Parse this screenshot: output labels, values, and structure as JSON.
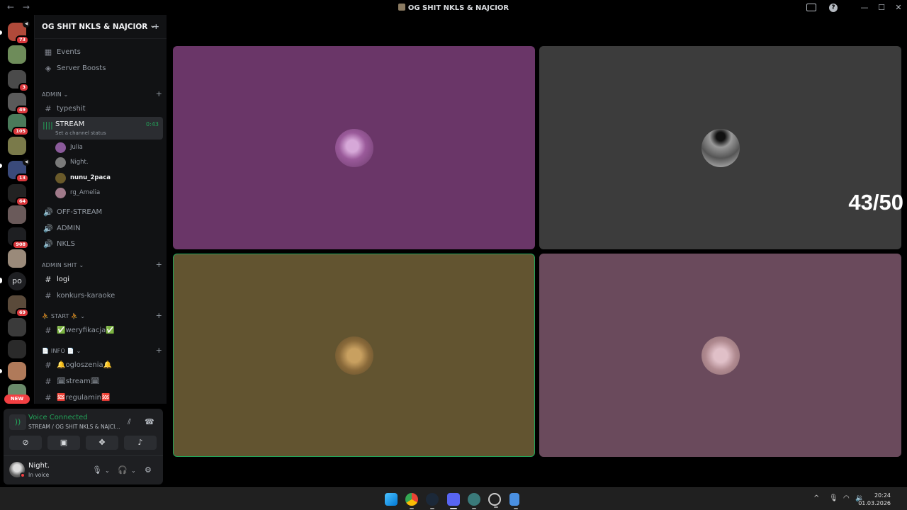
{
  "window": {
    "title": "OG SHIT NKLS & NAJCIOR",
    "back_glyph": "←",
    "forward_glyph": "→",
    "help_glyph": "?",
    "minimize_glyph": "—",
    "maximize_glyph": "☐",
    "close_glyph": "✕"
  },
  "rail": {
    "servers": [
      {
        "badge": "73",
        "color": "#b04a3a",
        "vol": true
      },
      {
        "badge": "",
        "color": "#6e8c5a"
      },
      {
        "badge": "3",
        "color": "#4a4a4a"
      },
      {
        "badge": "49",
        "color": "#5a5a5a"
      },
      {
        "badge": "105",
        "color": "#4a7a5a"
      },
      {
        "badge": "",
        "color": "#7a7a4a"
      },
      {
        "badge": "13",
        "color": "#3a4a7a",
        "vol": true
      },
      {
        "badge": "64",
        "color": "#222222"
      },
      {
        "badge": "",
        "color": "#6a5a5a"
      },
      {
        "badge": "908",
        "color": "#1e1f22"
      },
      {
        "badge": "",
        "color": "#9a8a7a"
      },
      {
        "badge": "",
        "color": "#1e1f22",
        "text": "po"
      },
      {
        "badge": "69",
        "color": "#5a4a3a"
      },
      {
        "badge": "",
        "color": "#3a3a3a"
      },
      {
        "badge": "",
        "color": "#2a2a2a"
      },
      {
        "badge": "",
        "color": "#b07a5a"
      },
      {
        "badge": "",
        "color": "#6a8a6a"
      }
    ],
    "new_label": "NEW"
  },
  "sidebar": {
    "server_name": "OG SHIT NKLS & NAJCIOR",
    "server_chevron": "⌄",
    "add_person_glyph": "👤",
    "top_items": [
      {
        "label": "Events",
        "icon": "calendar-icon",
        "glyph": "▦"
      },
      {
        "label": "Server Boosts",
        "icon": "boost-icon",
        "glyph": "◈"
      }
    ],
    "categories": {
      "admin": "ADMIN",
      "admin_shit": "ADMIN SHIT",
      "start": "⛹ START ⛹",
      "info": "📄 INFO 📄"
    },
    "channels": {
      "typeshit": "typeshit",
      "stream": "STREAM",
      "stream_status": "Set a channel status",
      "stream_time": "0:43",
      "off_stream": "OFF-STREAM",
      "admin_voice": "ADMIN",
      "nkls": "NKLS",
      "logi": "logi",
      "konkurs": "konkurs-karaoke",
      "weryfikacja": "✅weryfikacja✅",
      "ogloszenia": "🔔ogloszenia🔔",
      "stream_text": "🗓stream🗓",
      "regulamin": "🆘regulamin🆘"
    },
    "voice_users": [
      {
        "name": "Julia",
        "color": "#8a5a9a"
      },
      {
        "name": "Night.",
        "color": "#7a7a7a"
      },
      {
        "name": "nunu_2paca",
        "color": "#6a5a2a",
        "bold": true
      },
      {
        "name": "rg_Amelia",
        "color": "#a07a8a"
      }
    ]
  },
  "voice_panel": {
    "title": "Voice Connected",
    "subtitle": "STREAM / OG SHIT NKLS & NAJCI...",
    "buttons": [
      "camera-off",
      "screen-share",
      "activities",
      "soundboard"
    ],
    "user": {
      "name": "Night.",
      "state": "In voice"
    }
  },
  "stage": {
    "overlay_text": "43/50",
    "tiles": [
      {
        "user": "Julia",
        "bg": "#6a3668"
      },
      {
        "user": "Night.",
        "bg": "#3c3c3c"
      },
      {
        "user": "nunu_2paca",
        "bg": "#625430",
        "speaking": true
      },
      {
        "user": "rg_Amelia",
        "bg": "#6a4a5c"
      }
    ]
  },
  "taskbar": {
    "time": "20:24",
    "date": "01.03.2026",
    "chevron": "^"
  },
  "colors": {
    "accent_green": "#23a55a",
    "badge_red": "#da373c"
  }
}
